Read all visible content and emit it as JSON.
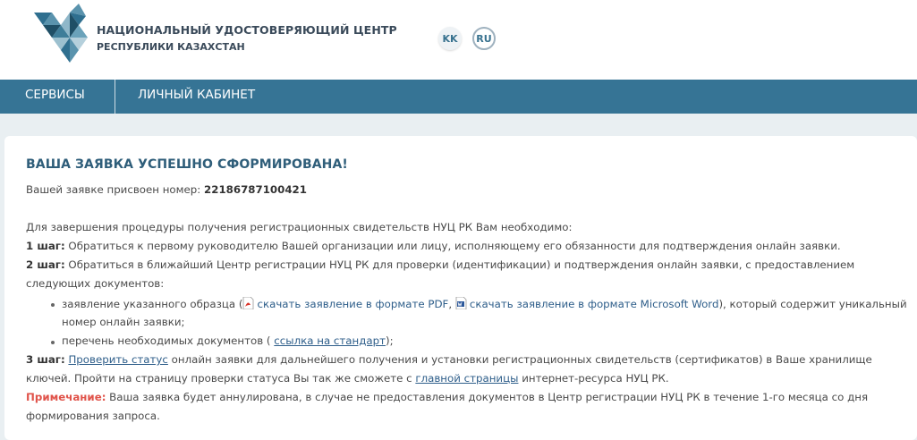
{
  "header": {
    "org_line1": "НАЦИОНАЛЬНЫЙ УДОСТОВЕРЯЮЩИЙ ЦЕНТР",
    "org_line2": "РЕСПУБЛИКИ КАЗАХСТАН",
    "lang_kk": "KK",
    "lang_ru": "RU",
    "logo_icon": "nuc-logo-icon"
  },
  "nav": {
    "services": "СЕРВИСЫ",
    "cabinet": "ЛИЧНЫЙ КАБИНЕТ"
  },
  "content": {
    "title": "ВАША ЗАЯВКА УСПЕШНО СФОРМИРОВАНА!",
    "assigned_prefix": "Вашей заявке присвоен номер: ",
    "request_number": "22186787100421",
    "intro": "Для завершения процедуры получения регистрационных свидетельств НУЦ РК Вам необходимо:",
    "step1_label": "1 шаг:",
    "step1_text": " Обратиться к первому руководителю Вашей организации или лицу, исполняющему его обязанности для подтверждения онлайн заявки.",
    "step2_label": "2 шаг:",
    "step2_text_a": " Обратиться в ближайший Центр регистрации НУЦ РК для проверки (идентификации) и подтверждения онлайн заявки, с предоставлением",
    "step2_text_b": "следующих документов:",
    "bullet1_prefix": "заявление указанного образца (",
    "download_pdf": "скачать заявление в формате PDF",
    "download_word": "скачать заявление в формате Microsoft Word",
    "bullet1_suffix_a": "), который содержит уникальный",
    "bullet1_suffix_b": "номер онлайн заявки;",
    "bullet2_prefix": "перечень необходимых документов ( ",
    "standard_link": "ссылка на стандарт",
    "bullet2_suffix": ");",
    "step3_label": "3 шаг:",
    "step3_link": "Проверить статус",
    "step3_text_a": " онлайн заявки для дальнейшего получения и установки регистрационных свидетельств (сертификатов) в Ваше хранилище",
    "step3_text_b_prefix": "ключей. Пройти на страницу проверки статуса Вы так же сможете с ",
    "main_page_link": "главной страницы",
    "step3_text_b_suffix": " интернет-ресурса НУЦ РК.",
    "note_label": "Примечание:",
    "note_text_a": " Ваша заявка будет аннулирована, в случае не предоставления документов в Центр регистрации НУЦ РК в течение 1-го месяца со дня",
    "note_text_b": "формирования запроса."
  },
  "colors": {
    "nav_bg": "#367495",
    "title": "#2f5e7a",
    "link": "#2e5e8a",
    "note": "#e0534a"
  }
}
